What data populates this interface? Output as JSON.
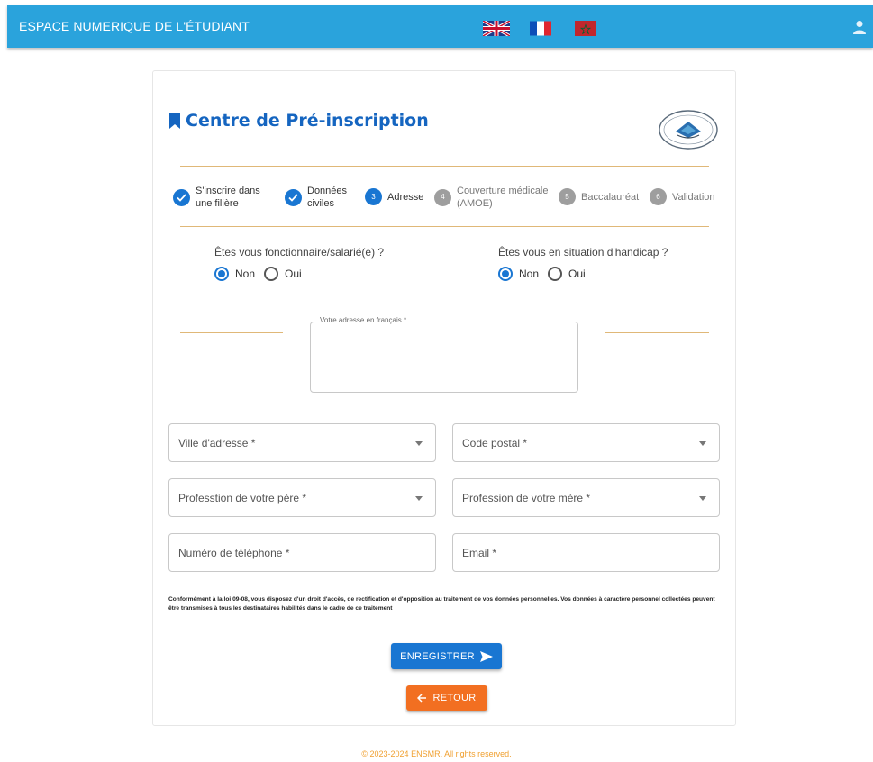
{
  "header": {
    "brand": "ESPACE NUMERIQUE DE L'ÉTUDIANT",
    "languages": [
      "english-flag",
      "french-flag",
      "arabic-flag"
    ]
  },
  "page": {
    "title": "Centre de Pré-inscription"
  },
  "steps": [
    {
      "label": "S'inscrire dans une filière",
      "state": "done"
    },
    {
      "label": "Données civiles",
      "state": "done"
    },
    {
      "number": "3",
      "label": "Adresse",
      "state": "active"
    },
    {
      "number": "4",
      "label": "Couverture médicale (AMOE)",
      "state": "pending"
    },
    {
      "number": "5",
      "label": "Baccalauréat",
      "state": "pending"
    },
    {
      "number": "6",
      "label": "Validation",
      "state": "pending"
    }
  ],
  "questions": {
    "fonctionnaire": {
      "label": "Êtes vous fonctionnaire/salarié(e) ?",
      "options": [
        "Non",
        "Oui"
      ],
      "selected": "Non"
    },
    "handicap": {
      "label": "Êtes vous en situation d'handicap ?",
      "options": [
        "Non",
        "Oui"
      ],
      "selected": "Non"
    }
  },
  "form": {
    "adresse_label": "Votre adresse en français *",
    "ville": "Ville d'adresse *",
    "code_postal": "Code postal *",
    "profession_pere": "Professtion de votre père *",
    "profession_mere": "Profession de votre mère *",
    "telephone": "Numéro de téléphone *",
    "email": "Email *"
  },
  "notice": "Conformément à la loi 09-08, vous disposez d'un droit d'accès, de rectification et d'opposition au traitement de vos données personnelles. Vos données à caractère personnel collectées peuvent être transmises à tous les destinataires habilités dans le cadre de ce traitement",
  "buttons": {
    "save": "ENREGISTRER",
    "back": "RETOUR"
  },
  "footer": "© 2023-2024 ENSMR. All rights reserved.",
  "colors": {
    "header": "#2aa3dc",
    "primary": "#1976d2",
    "back_button": "#f26f21",
    "divider": "#e0b878",
    "footer_text": "#f0a030"
  }
}
